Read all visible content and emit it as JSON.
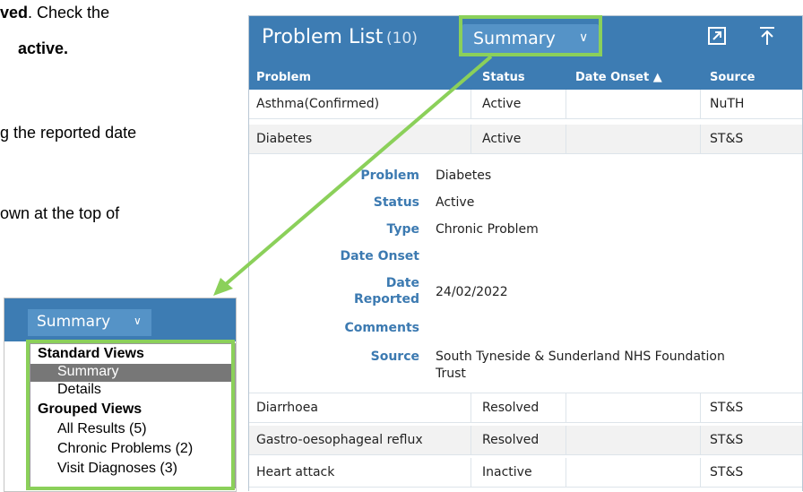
{
  "document": {
    "line1_bold": "ved",
    "line1_rest": ". Check the",
    "line2_bold": "active.",
    "line3": "g the reported date",
    "line4": "own at the top of"
  },
  "panel": {
    "title": "Problem List",
    "count": "(10)",
    "view_selected": "Summary",
    "columns": {
      "problem": "Problem",
      "status": "Status",
      "date_onset": "Date Onset ▲",
      "source": "Source"
    },
    "rows": [
      {
        "problem": "Asthma(Confirmed)",
        "status": "Active",
        "date_onset": "",
        "source": "NuTH"
      },
      {
        "problem": "Diabetes",
        "status": "Active",
        "date_onset": "",
        "source": "ST&S"
      },
      {
        "problem": "Diarrhoea",
        "status": "Resolved",
        "date_onset": "",
        "source": "ST&S"
      },
      {
        "problem": "Gastro-oesophageal reflux",
        "status": "Resolved",
        "date_onset": "",
        "source": "ST&S"
      },
      {
        "problem": "Heart attack",
        "status": "Inactive",
        "date_onset": "",
        "source": "ST&S"
      }
    ],
    "detail": {
      "problem_label": "Problem",
      "problem": "Diabetes",
      "status_label": "Status",
      "status": "Active",
      "type_label": "Type",
      "type": "Chronic Problem",
      "date_onset_label": "Date Onset",
      "date_onset": "",
      "date_reported_label_1": "Date",
      "date_reported_label_2": "Reported",
      "date_reported": "24/02/2022",
      "comments_label": "Comments",
      "comments": "",
      "source_label": "Source",
      "source_1": "South Tyneside & Sunderland NHS Foundation",
      "source_2": "Trust"
    }
  },
  "inset": {
    "view_selected": "Summary",
    "menu": {
      "standard_views": "Standard Views",
      "summary": "Summary",
      "details": "Details",
      "grouped_views": "Grouped Views",
      "all_results": "All Results (5)",
      "chronic_problems": "Chronic Problems (2)",
      "visit_diagnoses": "Visit Diagnoses (3)"
    }
  },
  "colors": {
    "header_blue": "#3d7cb3",
    "label_blue": "#3c7ab1",
    "highlight_green": "#8bd05a"
  }
}
